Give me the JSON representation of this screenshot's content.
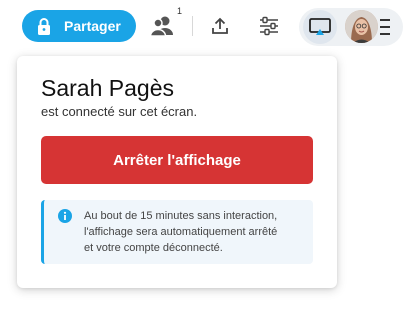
{
  "toolbar": {
    "share_label": "Partager",
    "users_count": "1",
    "icons": {
      "lock": "lock-icon",
      "users": "users-icon",
      "upload": "upload-icon",
      "settings": "sliders-icon",
      "cast": "cast-icon",
      "menu": "menu-icon"
    },
    "colors": {
      "accent": "#1aa4e6",
      "pill_bg": "#eef1f4"
    }
  },
  "popup": {
    "user_name": "Sarah Pagès",
    "status": "est connecté sur cet écran.",
    "stop_label": "Arrêter l'affichage",
    "info": {
      "line1": "Au bout de 15 minutes sans interaction,",
      "line2": "l'affichage sera automatiquement arrêté",
      "line3": "et votre compte déconnecté."
    },
    "colors": {
      "danger": "#d63434",
      "info_bg": "#f0f6fb",
      "info_accent": "#1aa4e6"
    }
  }
}
